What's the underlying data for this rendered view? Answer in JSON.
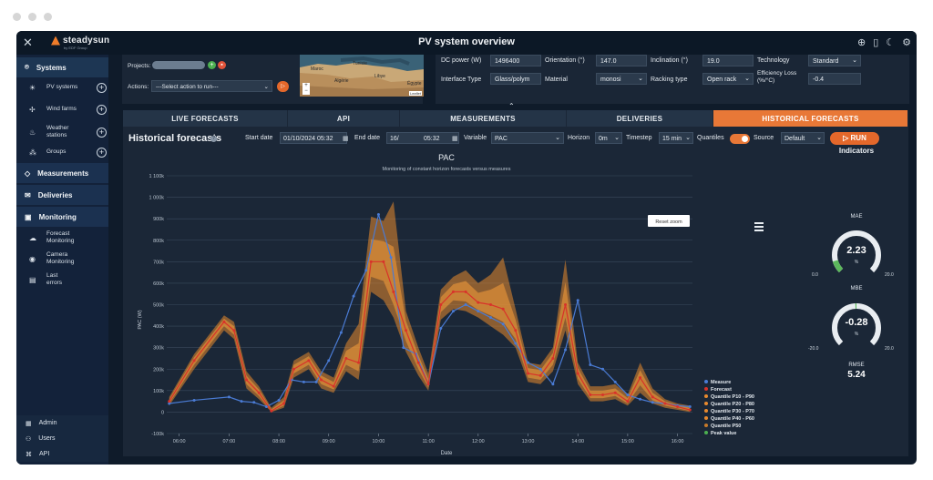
{
  "app": {
    "title": "PV system overview",
    "logo": "steadysun",
    "logo_sub": "by EDF Group",
    "top_icons": [
      "plus-circle-icon",
      "book-icon",
      "moon-icon",
      "gear-icon"
    ]
  },
  "sidebar": {
    "sections": [
      {
        "name": "systems",
        "label": "Systems",
        "icon": "map-pin-icon"
      },
      {
        "name": "measurements",
        "label": "Measurements",
        "icon": "ruler-icon"
      },
      {
        "name": "deliveries",
        "label": "Deliveries",
        "icon": "envelope-icon"
      },
      {
        "name": "monitoring",
        "label": "Monitoring",
        "icon": "monitor-icon"
      }
    ],
    "system_items": [
      {
        "label": "PV systems",
        "icon": "solar-panel-icon"
      },
      {
        "label": "Wind farms",
        "icon": "wind-turbine-icon"
      },
      {
        "label": "Weather stations",
        "icon": "weather-station-icon"
      },
      {
        "label": "Groups",
        "icon": "groups-icon"
      }
    ],
    "monitoring_items": [
      {
        "label": "Forecast Monitoring",
        "icon": "cloud-sync-icon"
      },
      {
        "label": "Camera Monitoring",
        "icon": "camera-icon"
      },
      {
        "label": "Last errors",
        "icon": "error-log-icon"
      }
    ],
    "bottom": [
      {
        "label": "Admin",
        "icon": "admin-icon"
      },
      {
        "label": "Users",
        "icon": "users-icon"
      },
      {
        "label": "API",
        "icon": "api-icon"
      }
    ]
  },
  "config_left": {
    "projects_label": "Projects:",
    "actions_label": "Actions:",
    "actions_value": "---Select action to run---",
    "map_labels": [
      "Tunisie",
      "Maroc",
      "Algérie",
      "Libye",
      "Égypte"
    ],
    "map_attribution": "Leaflet"
  },
  "config_right": {
    "dc_power_label": "DC power (W)",
    "dc_power": "1496400",
    "orientation_label": "Orientation (°)",
    "orientation": "147.0",
    "inclination_label": "Inclination (°)",
    "inclination": "19.0",
    "technology_label": "Technology",
    "technology": "Standard",
    "interface_label": "Interface Type",
    "interface": "Glass/polym",
    "material_label": "Material",
    "material": "monosi",
    "racking_label": "Racking type",
    "racking": "Open rack",
    "efficiency_label": "Efficiency Loss (%/°C)",
    "efficiency": "-0.4"
  },
  "tabs": [
    {
      "label": "LIVE FORECASTS",
      "active": false
    },
    {
      "label": "API",
      "active": false
    },
    {
      "label": "MEASUREMENTS",
      "active": false
    },
    {
      "label": "DELIVERIES",
      "active": false
    },
    {
      "label": "HISTORICAL FORECASTS",
      "active": true
    }
  ],
  "controls": {
    "title": "Historical forecasts",
    "start_label": "Start date",
    "start_value": "01/10/2024 05:32",
    "end_label": "End date",
    "end_value": "16/",
    "end_time": "05:32",
    "variable_label": "Variable",
    "variable_value": "PAC",
    "horizon_label": "Horizon",
    "horizon_value": "0m",
    "timestep_label": "Timestep",
    "timestep_value": "15 min",
    "quantiles_label": "Quantiles",
    "source_label": "Source",
    "source_value": "Default",
    "run_label": "RUN"
  },
  "colors": {
    "accent": "#e87837",
    "measure": "#4a7bd4",
    "forecast": "#d8322a",
    "quantile": "#e88a2e"
  },
  "chart_data": {
    "type": "line",
    "title": "PAC",
    "subtitle": "Monitoring of constant horizon forecasts versus measures",
    "xlabel": "Date",
    "ylabel": "PAC (W)",
    "reset_zoom": "Reset zoom",
    "ylim": [
      -100000,
      1100000
    ],
    "yticks": [
      -100000,
      0,
      100000,
      200000,
      300000,
      400000,
      500000,
      600000,
      700000,
      800000,
      900000,
      1000000,
      1100000
    ],
    "ytick_labels": [
      "-100k",
      "0",
      "100k",
      "200k",
      "300k",
      "400k",
      "500k",
      "600k",
      "700k",
      "800k",
      "900k",
      "1 000k",
      "1 100k"
    ],
    "xticks": [
      6.0,
      7.0,
      8.0,
      9.0,
      10.0,
      11.0,
      12.0,
      13.0,
      14.0,
      15.0,
      16.0
    ],
    "xtick_labels": [
      "06:00",
      "07:00",
      "08:00",
      "09:00",
      "10:00",
      "11:00",
      "12:00",
      "13:00",
      "14:00",
      "15:00",
      "16:00"
    ],
    "xlim": [
      5.75,
      16.3
    ],
    "legend": [
      "Measure",
      "Forecast",
      "Quantile P10 - P90",
      "Quantile P20 - P80",
      "Quantile P30 - P70",
      "Quantile P40 - P60",
      "Quantile P50",
      "Peak value"
    ],
    "legend_position": "right",
    "series": [
      {
        "name": "Measure",
        "x": [
          5.8,
          6.3,
          7.0,
          7.25,
          7.5,
          7.75,
          8.0,
          8.25,
          8.5,
          8.75,
          9.0,
          9.25,
          9.5,
          9.75,
          10.0,
          10.25,
          10.5,
          10.75,
          11.0,
          11.25,
          11.5,
          11.75,
          12.0,
          12.25,
          12.5,
          12.75,
          13.0,
          13.25,
          13.5,
          13.75,
          14.0,
          14.25,
          14.5,
          14.75,
          15.0,
          15.25,
          15.5,
          15.75,
          16.0,
          16.25
        ],
        "y": [
          40000,
          55000,
          70000,
          50000,
          45000,
          25000,
          55000,
          150000,
          140000,
          140000,
          240000,
          370000,
          540000,
          660000,
          920000,
          720000,
          300000,
          270000,
          130000,
          390000,
          470000,
          500000,
          470000,
          440000,
          410000,
          320000,
          230000,
          200000,
          130000,
          290000,
          520000,
          220000,
          200000,
          140000,
          80000,
          60000,
          45000,
          40000,
          30000,
          25000
        ]
      },
      {
        "name": "Forecast",
        "x": [
          5.8,
          6.3,
          6.9,
          7.1,
          7.35,
          7.6,
          7.85,
          8.1,
          8.3,
          8.6,
          8.85,
          9.1,
          9.35,
          9.6,
          9.85,
          10.1,
          10.3,
          10.55,
          10.8,
          11.0,
          11.25,
          11.5,
          11.75,
          12.0,
          12.25,
          12.5,
          12.75,
          13.0,
          13.25,
          13.5,
          13.75,
          14.0,
          14.25,
          14.5,
          14.75,
          15.0,
          15.25,
          15.5,
          15.75,
          16.0,
          16.25
        ],
        "y": [
          50000,
          240000,
          420000,
          380000,
          150000,
          90000,
          5000,
          40000,
          200000,
          240000,
          150000,
          120000,
          250000,
          230000,
          700000,
          700000,
          560000,
          380000,
          230000,
          130000,
          500000,
          560000,
          560000,
          510000,
          500000,
          480000,
          380000,
          180000,
          170000,
          250000,
          500000,
          180000,
          80000,
          80000,
          90000,
          50000,
          160000,
          70000,
          40000,
          25000,
          10000
        ]
      },
      {
        "name": "Quantile P10 - P90",
        "x": [
          5.8,
          6.3,
          6.9,
          7.1,
          7.35,
          7.6,
          7.85,
          8.1,
          8.3,
          8.6,
          8.85,
          9.1,
          9.35,
          9.6,
          9.85,
          10.1,
          10.3,
          10.55,
          10.8,
          11.0,
          11.25,
          11.5,
          11.75,
          12.0,
          12.25,
          12.5,
          12.75,
          13.0,
          13.25,
          13.5,
          13.75,
          14.0,
          14.25,
          14.5,
          14.75,
          15.0,
          15.25,
          15.5,
          15.75,
          16.0,
          16.25
        ],
        "low": [
          30000,
          200000,
          380000,
          340000,
          110000,
          60000,
          0,
          20000,
          160000,
          200000,
          110000,
          90000,
          190000,
          150000,
          560000,
          520000,
          440000,
          280000,
          170000,
          100000,
          430000,
          480000,
          470000,
          440000,
          400000,
          360000,
          300000,
          140000,
          130000,
          190000,
          380000,
          130000,
          50000,
          50000,
          60000,
          30000,
          90000,
          40000,
          20000,
          10000,
          0
        ],
        "high": [
          70000,
          270000,
          450000,
          420000,
          190000,
          120000,
          20000,
          70000,
          240000,
          280000,
          190000,
          160000,
          320000,
          410000,
          910000,
          890000,
          980000,
          470000,
          300000,
          180000,
          570000,
          630000,
          660000,
          600000,
          640000,
          720000,
          480000,
          230000,
          220000,
          300000,
          710000,
          230000,
          120000,
          120000,
          130000,
          80000,
          230000,
          110000,
          60000,
          40000,
          30000
        ]
      }
    ]
  },
  "indicators": {
    "title": "Indicators",
    "mae": {
      "label": "MAE",
      "value": "2.23",
      "unit": "%",
      "min": "0.0",
      "max": "20.0",
      "fraction": 0.11
    },
    "mbe": {
      "label": "MBE",
      "value": "-0.28",
      "unit": "%",
      "min": "-20.0",
      "max": "20.0",
      "fraction": 0.49
    },
    "rmse": {
      "label": "RMSE",
      "value": "5.24"
    }
  }
}
